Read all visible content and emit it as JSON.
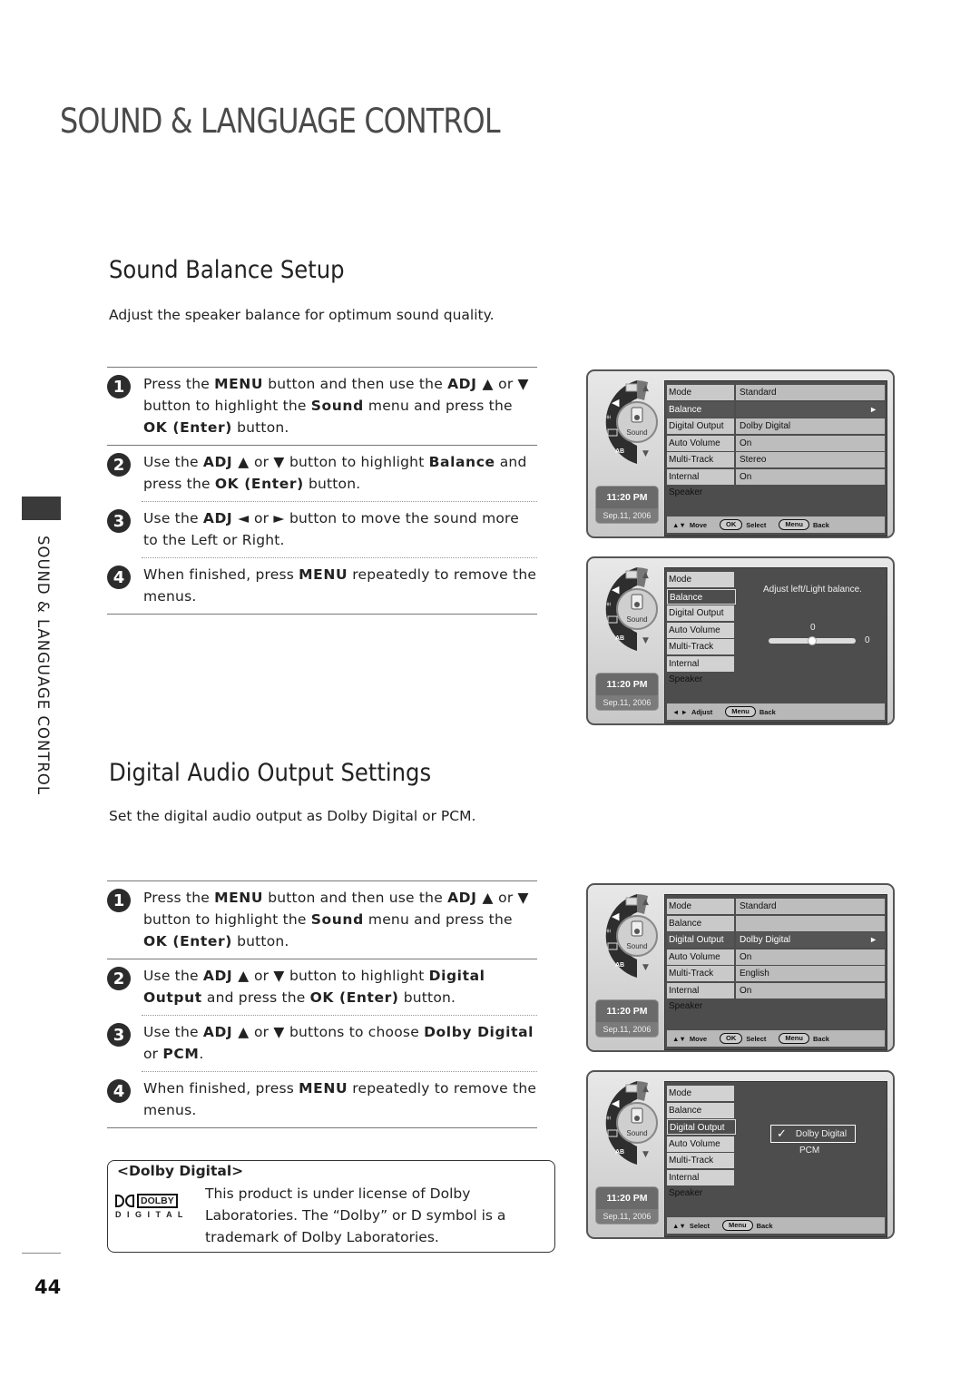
{
  "page": {
    "title": "SOUND & LANGUAGE CONTROL",
    "side_tab": "SOUND & LANGUAGE CONTROL",
    "page_number": "44"
  },
  "balance": {
    "title": "Sound Balance Setup",
    "intro": "Adjust the speaker balance for optimum sound quality.",
    "steps": [
      {
        "num": "1",
        "html": "Press the <b>MENU</b> button and then use the <b>ADJ ▲</b> or <b>▼</b> button to highlight the <b>Sound</b> menu and press the <b>OK (Enter)</b> button."
      },
      {
        "num": "2",
        "html": "Use the <b>ADJ ▲</b> or <b>▼</b> button to highlight <b>Balance</b> and press the <b>OK (Enter)</b> button."
      },
      {
        "num": "3",
        "html": "Use the <b>ADJ ◄</b> or <b>►</b> button to move the sound more to the Left or Right."
      },
      {
        "num": "4",
        "html": "When finished, press <b>MENU</b> repeatedly to remove the menus."
      }
    ]
  },
  "digital": {
    "title": "Digital Audio Output Settings",
    "intro": "Set the digital audio output as Dolby Digital or PCM.",
    "steps": [
      {
        "num": "1",
        "html": "Press the <b>MENU</b> button and then use the <b>ADJ ▲</b> or <b>▼</b> button to highlight the <b>Sound</b> menu and press the <b>OK (Enter)</b> button."
      },
      {
        "num": "2",
        "html": "Use the <b>ADJ ▲</b> or <b>▼</b> button to highlight <b>Digital Output</b> and press the <b>OK (Enter)</b> button."
      },
      {
        "num": "3",
        "html": "Use the <b>ADJ ▲</b> or <b>▼</b> buttons to choose <b>Dolby Digital</b> or <b>PCM</b>."
      },
      {
        "num": "4",
        "html": "When finished, press <b>MENU</b> repeatedly to remove the menus."
      }
    ],
    "note": {
      "title": "<Dolby Digital>",
      "logo_top": "DOLBY",
      "logo_bottom": "D I G I T A L",
      "body": "This product is under license of Dolby Laboratories. The “Dolby” or D symbol is a trademark of Dolby Laboratories."
    }
  },
  "osd": {
    "wheel_label": "Sound",
    "time": "11:20 PM",
    "date": "Sep.11, 2006",
    "screens": [
      {
        "rows": [
          [
            "Mode",
            "Standard"
          ],
          [
            "Balance",
            ""
          ],
          [
            "Digital Output",
            "Dolby Digital"
          ],
          [
            "Auto Volume",
            "On"
          ],
          [
            "Multi-Track",
            "Stereo"
          ],
          [
            "Internal Speaker",
            "On"
          ]
        ],
        "selected": 1,
        "footer": [
          {
            "key": "▲▼",
            "label": "Move"
          },
          {
            "pill": "OK",
            "label": "Select"
          },
          {
            "pill": "Menu",
            "label": "Back"
          }
        ]
      },
      {
        "rows": [
          [
            "Mode",
            ""
          ],
          [
            "Balance",
            ""
          ],
          [
            "Digital Output",
            ""
          ],
          [
            "Auto Volume",
            ""
          ],
          [
            "Multi-Track",
            ""
          ],
          [
            "Internal Speaker",
            ""
          ]
        ],
        "selected": 1,
        "message": "Adjust left/Light balance.",
        "slider": {
          "value_top": "0",
          "value_right": "0",
          "position": 0.5
        },
        "footer": [
          {
            "key": "◄ ►",
            "label": "Adjust"
          },
          {
            "pill": "Menu",
            "label": "Back"
          }
        ]
      },
      {
        "rows": [
          [
            "Mode",
            "Standard"
          ],
          [
            "Balance",
            ""
          ],
          [
            "Digital Output",
            "Dolby Digital"
          ],
          [
            "Auto Volume",
            "On"
          ],
          [
            "Multi-Track",
            "English"
          ],
          [
            "Internal Speaker",
            "On"
          ]
        ],
        "selected": 2,
        "footer": [
          {
            "key": "▲▼",
            "label": "Move"
          },
          {
            "pill": "OK",
            "label": "Select"
          },
          {
            "pill": "Menu",
            "label": "Back"
          }
        ]
      },
      {
        "rows": [
          [
            "Mode",
            ""
          ],
          [
            "Balance",
            ""
          ],
          [
            "Digital Output",
            ""
          ],
          [
            "Auto Volume",
            ""
          ],
          [
            "Multi-Track",
            ""
          ],
          [
            "Internal Speaker",
            ""
          ]
        ],
        "selected": 2,
        "options": [
          {
            "label": "Dolby Digital",
            "checked": true
          },
          {
            "label": "PCM",
            "checked": false
          }
        ],
        "footer": [
          {
            "key": "▲▼",
            "label": "Select"
          },
          {
            "pill": "Menu",
            "label": "Back"
          }
        ]
      }
    ]
  }
}
